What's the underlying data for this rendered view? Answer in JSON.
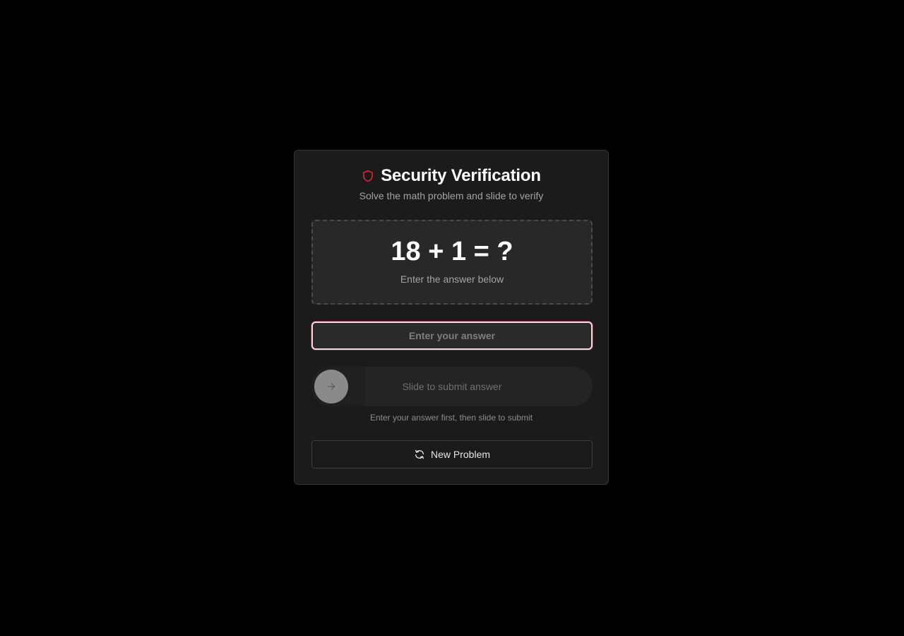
{
  "header": {
    "title": "Security Verification",
    "subtitle": "Solve the math problem and slide to verify",
    "icon": "shield-icon",
    "accent_color": "#e5242d"
  },
  "problem": {
    "equation": "18 + 1 = ?",
    "hint": "Enter the answer below"
  },
  "answer": {
    "value": "",
    "placeholder": "Enter your answer"
  },
  "slider": {
    "label": "Slide to submit answer",
    "progress": 0,
    "icon": "arrow-right-icon"
  },
  "instruction": "Enter your answer first, then slide to submit",
  "new_problem_button": {
    "label": "New Problem",
    "icon": "refresh-icon"
  }
}
